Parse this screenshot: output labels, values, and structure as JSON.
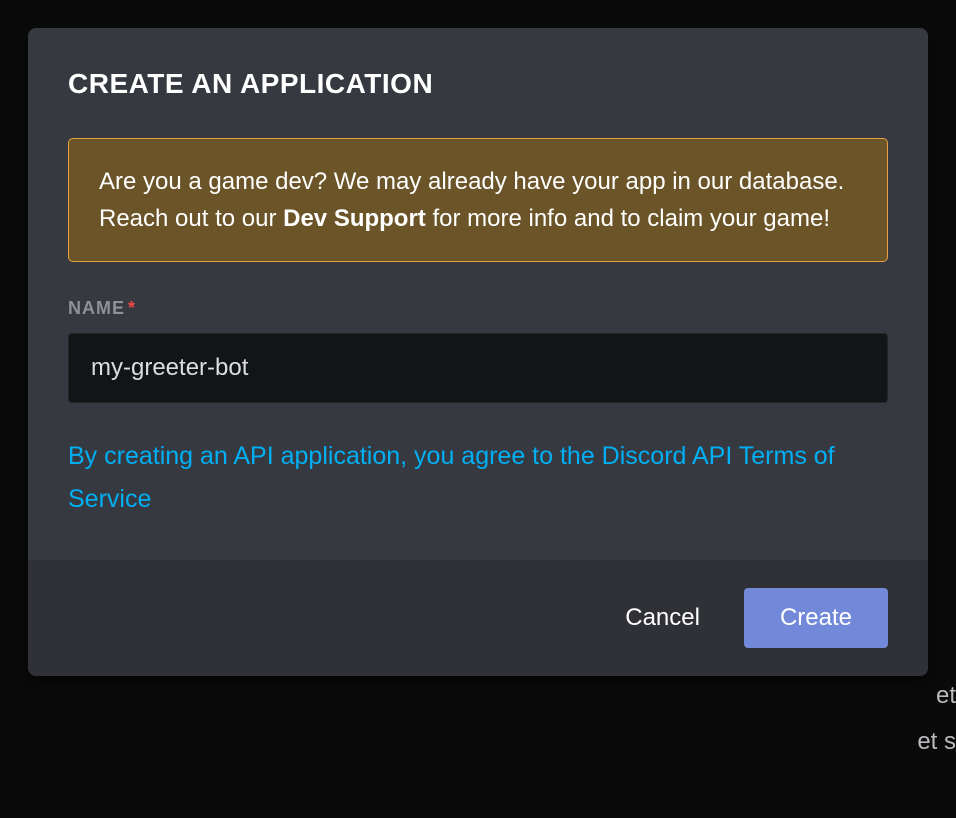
{
  "modal": {
    "title": "CREATE AN APPLICATION",
    "notice": {
      "prefix": "Are you a game dev? We may already have your app in our database. Reach out to our ",
      "bold": "Dev Support",
      "suffix": " for more info and to claim your game!"
    },
    "name_field": {
      "label": "NAME",
      "required_mark": "*",
      "value": "my-greeter-bot"
    },
    "tos_text": "By creating an API application, you agree to the Discord API Terms of Service",
    "buttons": {
      "cancel": "Cancel",
      "create": "Create"
    }
  },
  "background": {
    "line1": "et",
    "line2": "et s"
  }
}
